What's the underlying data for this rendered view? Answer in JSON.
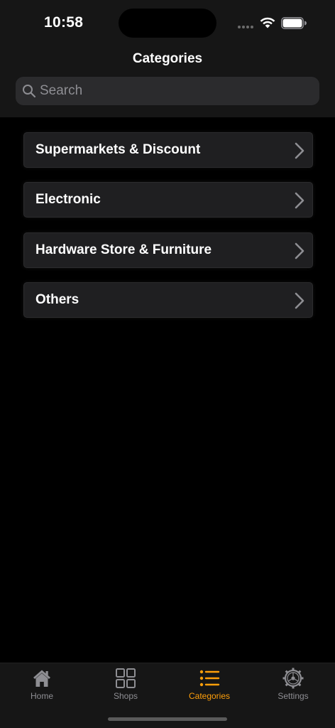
{
  "status_bar": {
    "time": "10:58"
  },
  "header": {
    "title": "Categories"
  },
  "search": {
    "placeholder": "Search",
    "value": ""
  },
  "categories": [
    {
      "label": "Supermarkets & Discount"
    },
    {
      "label": "Electronic"
    },
    {
      "label": "Hardware Store & Furniture"
    },
    {
      "label": "Others"
    }
  ],
  "tab_bar": {
    "items": [
      {
        "label": "Home",
        "icon": "house-icon"
      },
      {
        "label": "Shops",
        "icon": "grid-icon"
      },
      {
        "label": "Categories",
        "icon": "list-icon"
      },
      {
        "label": "Settings",
        "icon": "gear-icon"
      }
    ],
    "active": "Categories"
  },
  "colors": {
    "accent": "#ff9f0a",
    "inactive": "#8e8e93",
    "background": "#000000",
    "card": "#1f1f21"
  }
}
